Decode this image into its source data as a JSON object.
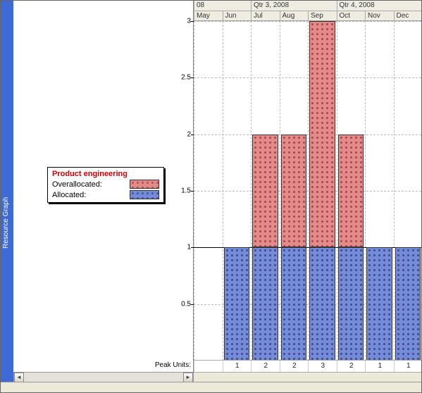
{
  "sidebar_title": "Resource Graph",
  "legend": {
    "title": "Product engineering",
    "over_label": "Overallocated:",
    "alloc_label": "Allocated:",
    "over_color": "#e58a8a",
    "alloc_color": "#768bd8"
  },
  "peak_units_label": "Peak Units:",
  "status_text": "",
  "timeline": {
    "year_suffix_partial": "08",
    "quarters": [
      {
        "label": "Qtr 3, 2008",
        "start_index": 2
      },
      {
        "label": "Qtr 4, 2008",
        "start_index": 5
      }
    ],
    "months": [
      "May",
      "Jun",
      "Jul",
      "Aug",
      "Sep",
      "Oct",
      "Nov",
      "Dec"
    ]
  },
  "chart_data": {
    "type": "bar",
    "title": "",
    "ylabel": "",
    "xlabel": "",
    "ylim": [
      0,
      3
    ],
    "y_ticks": [
      0.5,
      1,
      1.5,
      2,
      2.5,
      3
    ],
    "categories": [
      "May",
      "Jun",
      "Jul",
      "Aug",
      "Sep",
      "Oct",
      "Nov",
      "Dec"
    ],
    "series": [
      {
        "name": "Allocated",
        "color": "#768bd8",
        "values": [
          0,
          1,
          1,
          1,
          1,
          1,
          1,
          1
        ]
      },
      {
        "name": "Overallocated",
        "color": "#e58a8a",
        "values": [
          0,
          0,
          1,
          1,
          2,
          1,
          0,
          0
        ]
      }
    ],
    "peak_units": [
      null,
      1,
      2,
      2,
      3,
      2,
      1,
      1
    ]
  }
}
